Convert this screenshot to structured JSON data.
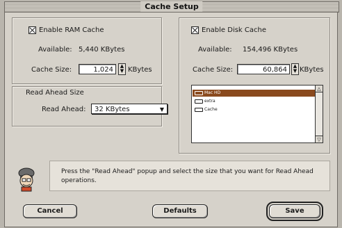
{
  "window": {
    "title": "Cache Setup"
  },
  "ram": {
    "checkbox_label": "Enable RAM Cache",
    "available_label": "Available:",
    "available_value": "5,440 KBytes",
    "cache_size_label": "Cache Size:",
    "cache_size_value": "1,024",
    "unit": "KBytes"
  },
  "read_ahead": {
    "group_title": "Read Ahead Size",
    "label": "Read Ahead:",
    "value": "32 KBytes"
  },
  "disk": {
    "checkbox_label": "Enable Disk Cache",
    "available_label": "Available:",
    "available_value": "154,496 KBytes",
    "cache_size_label": "Cache Size:",
    "cache_size_value": "60,864",
    "unit": "KBytes",
    "volumes": [
      "Mac HD",
      "extra",
      "Cache"
    ]
  },
  "help": {
    "text": "Press the \"Read Ahead\" popup and select the size that you want for Read Ahead operations."
  },
  "buttons": {
    "cancel": "Cancel",
    "defaults": "Defaults",
    "save": "Save"
  },
  "icons": {
    "help": "assistant-face-icon",
    "disk": "disk-icon",
    "stepper": "stepper-arrows-icon",
    "popup": "popup-arrow-icon",
    "scroll": "scroll-arrow-icon"
  },
  "colors": {
    "selection": "#8a4a1e",
    "window_bg": "#d6d2ca"
  }
}
